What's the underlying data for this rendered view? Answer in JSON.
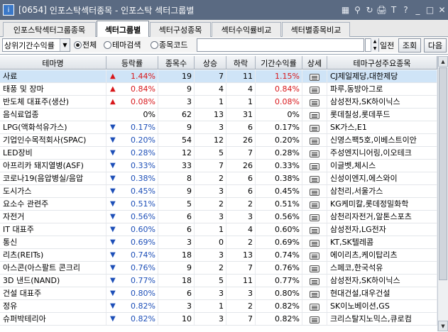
{
  "window": {
    "code": "[0654]",
    "title": "인포스탁섹터종목 - 인포스탁 섹터그룹별",
    "icons": [
      "grid-icon",
      "pin-icon",
      "refresh-icon",
      "print-icon",
      "text-size-icon",
      "help-icon",
      "minimize-icon",
      "maximize-icon",
      "close-icon"
    ],
    "icon_glyphs": [
      "▦",
      "⚲",
      "↻",
      "🖨",
      "T",
      "?",
      "_",
      "□",
      "✕"
    ]
  },
  "tabs": [
    "인포스탁섹터그룹종목",
    "섹터그룹별",
    "섹터구성종목",
    "섹터수익률비교",
    "섹터별종목비교"
  ],
  "active_tab": 1,
  "toolbar": {
    "combo_value": "상위기간수익률",
    "combo_arrow": "▼",
    "radio_all": "전체",
    "radio_theme": "테마검색",
    "radio_stock": "종목코드",
    "search_value": "",
    "days_value": "1",
    "days_unit": "일전",
    "query_button": "조회",
    "next_button": "다음",
    "spin_up": "▲",
    "spin_down": "▼"
  },
  "columns": [
    "테마명",
    "등락률",
    "종목수",
    "상승",
    "하락",
    "기간수익률",
    "상세",
    "테마구성주요종목"
  ],
  "colors": {
    "up": "#d8171b",
    "down": "#1d4fb8",
    "selected_row": "#cfe4f7"
  },
  "rows": [
    {
      "name": "사료",
      "dir": "up",
      "arrow": "▲",
      "rate": "1.44%",
      "count": "19",
      "rise": "7",
      "fall": "11",
      "period": "1.15%",
      "stocks": "CJ제일제당,대한제당"
    },
    {
      "name": "태풍 및 장마",
      "dir": "up",
      "arrow": "▲",
      "rate": "0.84%",
      "count": "9",
      "rise": "4",
      "fall": "4",
      "period": "0.84%",
      "stocks": "파루,동방아그로"
    },
    {
      "name": "반도체 대표주(생산)",
      "dir": "up",
      "arrow": "▲",
      "rate": "0.08%",
      "count": "3",
      "rise": "1",
      "fall": "1",
      "period": "0.08%",
      "stocks": "삼성전자,SK하이닉스"
    },
    {
      "name": "음식료업종",
      "dir": "none",
      "arrow": "",
      "rate": "0%",
      "count": "62",
      "rise": "13",
      "fall": "31",
      "period": "0%",
      "stocks": "롯데칠성,롯데푸드"
    },
    {
      "name": "LPG(액화석유가스)",
      "dir": "down",
      "arrow": "▼",
      "rate": "0.17%",
      "count": "9",
      "rise": "3",
      "fall": "6",
      "period": "0.17%",
      "stocks": "SK가스,E1"
    },
    {
      "name": "기업인수목적회사(SPAC)",
      "dir": "down",
      "arrow": "▼",
      "rate": "0.20%",
      "count": "54",
      "rise": "12",
      "fall": "26",
      "period": "0.20%",
      "stocks": "신영스팩5호,이베스트이안"
    },
    {
      "name": "LED장비",
      "dir": "down",
      "arrow": "▼",
      "rate": "0.28%",
      "count": "12",
      "rise": "5",
      "fall": "7",
      "period": "0.28%",
      "stocks": "주성엔지니어링,이오테크"
    },
    {
      "name": "아프리카 돼지열병(ASF)",
      "dir": "down",
      "arrow": "▼",
      "rate": "0.33%",
      "count": "33",
      "rise": "7",
      "fall": "26",
      "period": "0.33%",
      "stocks": "이글벳,체시스"
    },
    {
      "name": "코로나19(음압병실/음압",
      "dir": "down",
      "arrow": "▼",
      "rate": "0.38%",
      "count": "8",
      "rise": "2",
      "fall": "6",
      "period": "0.38%",
      "stocks": "신성이엔지,에스와이"
    },
    {
      "name": "도시가스",
      "dir": "down",
      "arrow": "▼",
      "rate": "0.45%",
      "count": "9",
      "rise": "3",
      "fall": "6",
      "period": "0.45%",
      "stocks": "삼천리,서울가스"
    },
    {
      "name": "요소수 관련주",
      "dir": "down",
      "arrow": "▼",
      "rate": "0.51%",
      "count": "5",
      "rise": "2",
      "fall": "2",
      "period": "0.51%",
      "stocks": "KG케미칼,롯데정밀화학"
    },
    {
      "name": "자전거",
      "dir": "down",
      "arrow": "▼",
      "rate": "0.56%",
      "count": "6",
      "rise": "3",
      "fall": "3",
      "period": "0.56%",
      "stocks": "삼천리자전거,알톤스포츠"
    },
    {
      "name": "IT 대표주",
      "dir": "down",
      "arrow": "▼",
      "rate": "0.60%",
      "count": "6",
      "rise": "1",
      "fall": "4",
      "period": "0.60%",
      "stocks": "삼성전자,LG전자"
    },
    {
      "name": "통신",
      "dir": "down",
      "arrow": "▼",
      "rate": "0.69%",
      "count": "3",
      "rise": "0",
      "fall": "2",
      "period": "0.69%",
      "stocks": "KT,SK텔레콤"
    },
    {
      "name": "리츠(REITs)",
      "dir": "down",
      "arrow": "▼",
      "rate": "0.74%",
      "count": "18",
      "rise": "3",
      "fall": "13",
      "period": "0.74%",
      "stocks": "에이리츠,케이탑리츠"
    },
    {
      "name": "아스콘(아스팔트 콘크리",
      "dir": "down",
      "arrow": "▼",
      "rate": "0.76%",
      "count": "9",
      "rise": "2",
      "fall": "7",
      "period": "0.76%",
      "stocks": "스페코,한국석유"
    },
    {
      "name": "3D 낸드(NAND)",
      "dir": "down",
      "arrow": "▼",
      "rate": "0.77%",
      "count": "18",
      "rise": "5",
      "fall": "11",
      "period": "0.77%",
      "stocks": "삼성전자,SK하이닉스"
    },
    {
      "name": "건설 대표주",
      "dir": "down",
      "arrow": "▼",
      "rate": "0.80%",
      "count": "6",
      "rise": "3",
      "fall": "3",
      "period": "0.80%",
      "stocks": "현대건설,대우건설"
    },
    {
      "name": "정유",
      "dir": "down",
      "arrow": "▼",
      "rate": "0.82%",
      "count": "3",
      "rise": "1",
      "fall": "2",
      "period": "0.82%",
      "stocks": "SK이노베이션,GS"
    },
    {
      "name": "슈퍼박테리아",
      "dir": "down",
      "arrow": "▼",
      "rate": "0.82%",
      "count": "10",
      "rise": "3",
      "fall": "7",
      "period": "0.82%",
      "stocks": "크리스탈지노믹스,큐로컴"
    }
  ]
}
